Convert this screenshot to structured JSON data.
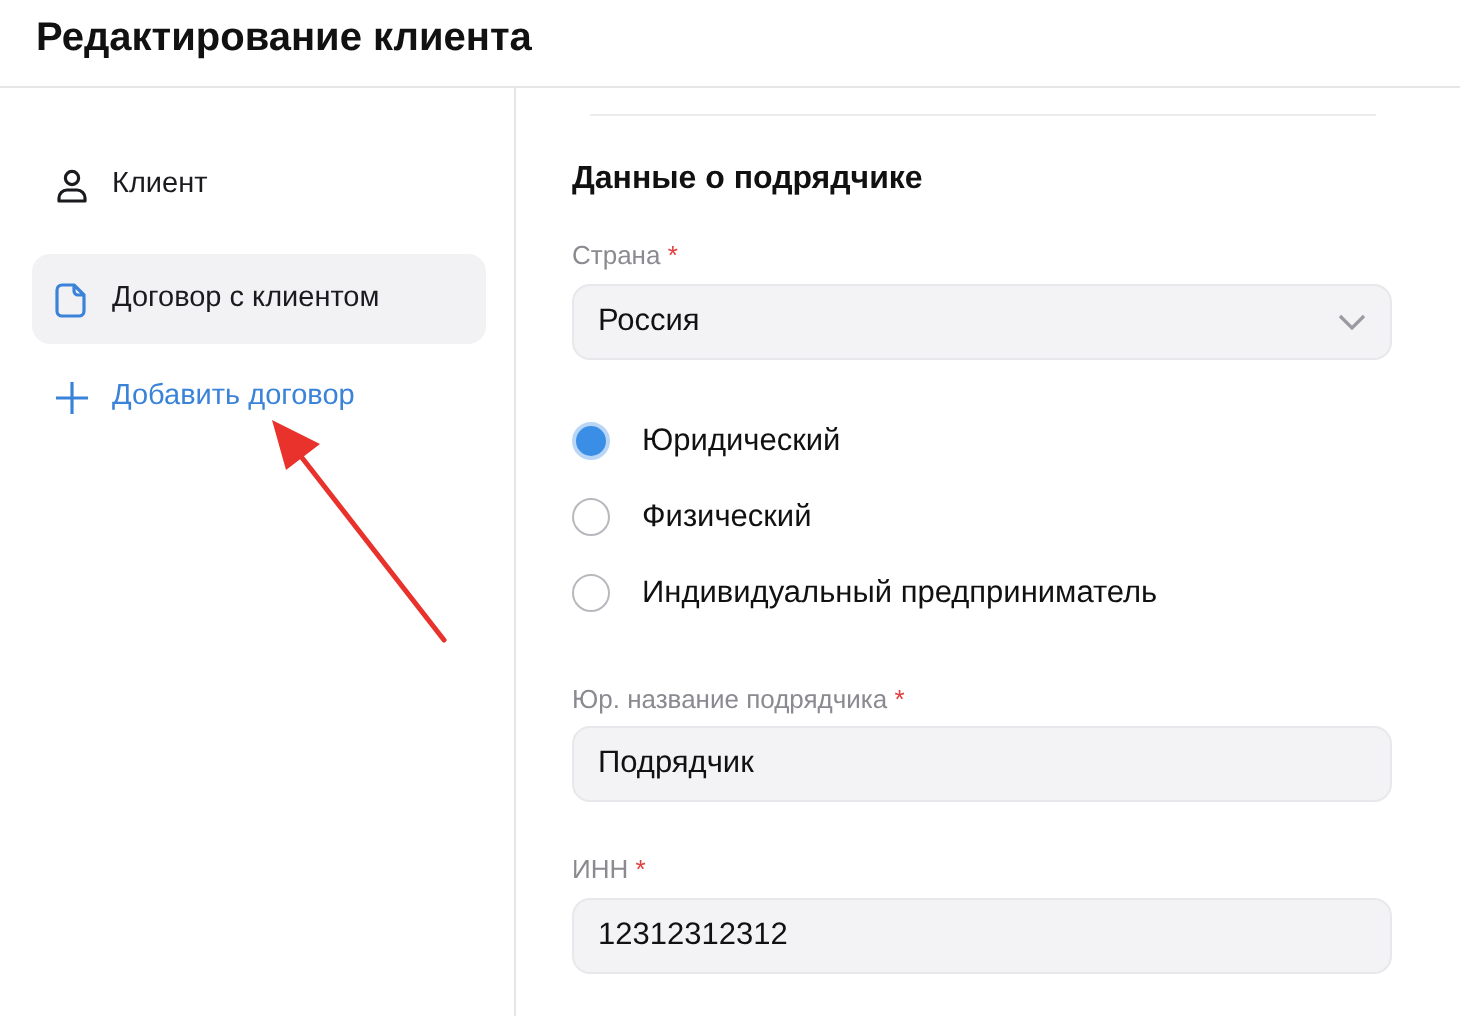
{
  "title": "Редактирование клиента",
  "sidebar": {
    "items": [
      {
        "label": "Клиент",
        "selected": false
      },
      {
        "label": "Договор с клиентом",
        "selected": true
      }
    ],
    "add_link": {
      "label": "Добавить договор"
    }
  },
  "section": {
    "title": "Данные о подрядчике",
    "fields": [
      {
        "kind": "select",
        "label": "Страна",
        "mark": "*",
        "value": "Россия"
      },
      {
        "kind": "radio_group",
        "options": [
          {
            "label": "Юридический",
            "selected": true
          },
          {
            "label": "Физический",
            "selected": false
          },
          {
            "label": "Индивидуальный предприниматель",
            "selected": false
          }
        ]
      },
      {
        "kind": "text",
        "label": "Юр. название подрядчика",
        "mark": "*",
        "value": "Подрядчик"
      },
      {
        "kind": "text",
        "label": "ИНН",
        "mark": "*",
        "value": "12312312312"
      }
    ]
  }
}
